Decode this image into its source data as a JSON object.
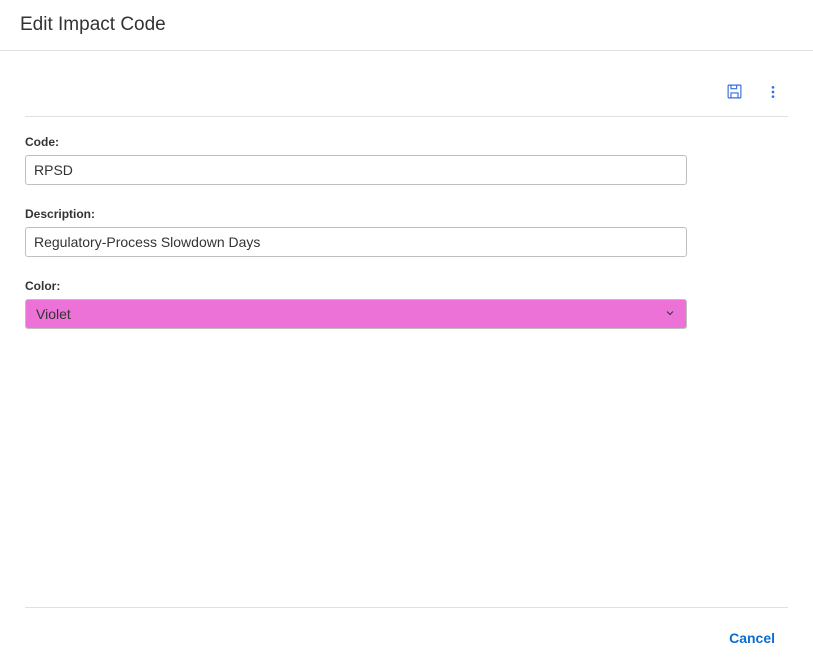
{
  "header": {
    "title": "Edit Impact Code"
  },
  "toolbar": {
    "save_icon": "save-icon",
    "overflow_icon": "more-vertical-icon"
  },
  "form": {
    "code": {
      "label": "Code:",
      "value": "RPSD"
    },
    "description": {
      "label": "Description:",
      "value": "Regulatory-Process Slowdown Days"
    },
    "color": {
      "label": "Color:",
      "selected": "Violet",
      "swatch": "#ed72d8"
    }
  },
  "footer": {
    "cancel_label": "Cancel"
  },
  "colors": {
    "accent": "#0a6ed1",
    "icon": "#346ee0"
  }
}
